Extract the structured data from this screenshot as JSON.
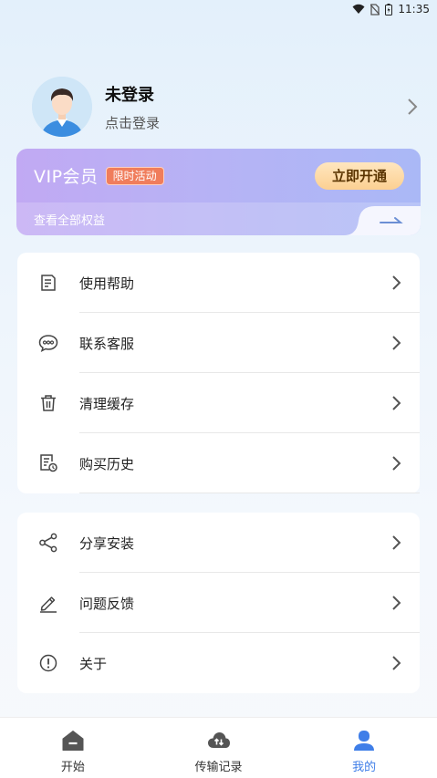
{
  "status_bar": {
    "time": "11:35"
  },
  "profile": {
    "name": "未登录",
    "subtitle": "点击登录"
  },
  "vip": {
    "title": "VIP会员",
    "tag": "限时活动",
    "button": "立即开通",
    "link": "查看全部权益"
  },
  "menu_group_1": [
    {
      "label": "使用帮助",
      "icon": "document-icon"
    },
    {
      "label": "联系客服",
      "icon": "chat-bubble-icon"
    },
    {
      "label": "清理缓存",
      "icon": "trash-icon"
    },
    {
      "label": "购买历史",
      "icon": "receipt-clock-icon"
    }
  ],
  "menu_group_2": [
    {
      "label": "分享安装",
      "icon": "share-icon"
    },
    {
      "label": "问题反馈",
      "icon": "pen-icon"
    },
    {
      "label": "关于",
      "icon": "info-icon"
    }
  ],
  "bottom_nav": [
    {
      "label": "开始",
      "icon": "home-icon",
      "active": false
    },
    {
      "label": "传输记录",
      "icon": "cloud-transfer-icon",
      "active": false
    },
    {
      "label": "我的",
      "icon": "user-icon",
      "active": true
    }
  ],
  "colors": {
    "accent": "#3f7ee8",
    "vip_tag": "#f07d5c",
    "vip_button": "#fcd092"
  }
}
